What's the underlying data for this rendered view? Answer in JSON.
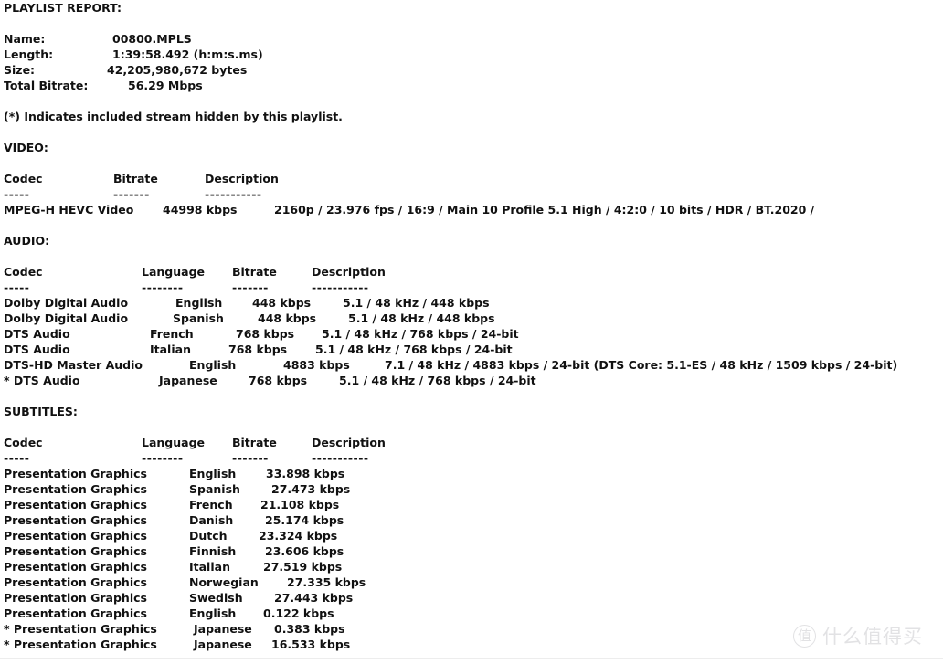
{
  "report": {
    "title": "PLAYLIST REPORT:",
    "note": "(*) Indicates included stream hidden by this playlist.",
    "meta": [
      {
        "key": "Name:",
        "value": "00800.MPLS"
      },
      {
        "key": "Length:",
        "value": "1:39:58.492 (h:m:s.ms)"
      },
      {
        "key": "Size:",
        "value": "42,205,980,672 bytes"
      },
      {
        "key": "Total Bitrate:",
        "value": "56.29 Mbps"
      }
    ],
    "video": {
      "heading": "VIDEO:",
      "columns": {
        "codec": "Codec",
        "bitrate": "Bitrate",
        "description": "Description"
      },
      "rules": {
        "codec": "-----",
        "bitrate": "-------",
        "description": "-----------"
      },
      "rows": [
        {
          "codec": "MPEG-H HEVC Video",
          "bitrate": "44998 kbps",
          "description": "2160p / 23.976 fps / 16:9 / Main 10 Profile 5.1 High / 4:2:0 / 10 bits / HDR / BT.2020 /"
        }
      ]
    },
    "audio": {
      "heading": "AUDIO:",
      "columns": {
        "codec": "Codec",
        "language": "Language",
        "bitrate": "Bitrate",
        "description": "Description"
      },
      "rules": {
        "codec": "-----",
        "language": "--------",
        "bitrate": "-------",
        "description": "-----------"
      },
      "rows": [
        {
          "codec": "Dolby Digital Audio",
          "language": "English",
          "bitrate": "448 kbps",
          "description": "5.1 / 48 kHz / 448 kbps"
        },
        {
          "codec": "Dolby Digital Audio",
          "language": "Spanish",
          "bitrate": "448 kbps",
          "description": "5.1 / 48 kHz / 448 kbps"
        },
        {
          "codec": "DTS Audio",
          "language": "French",
          "bitrate": "768 kbps",
          "description": "5.1 / 48 kHz / 768 kbps / 24-bit"
        },
        {
          "codec": "DTS Audio",
          "language": "Italian",
          "bitrate": "768 kbps",
          "description": "5.1 / 48 kHz / 768 kbps / 24-bit"
        },
        {
          "codec": "DTS-HD Master Audio",
          "language": "English",
          "bitrate": "4883 kbps",
          "description": "7.1 / 48 kHz / 4883 kbps / 24-bit (DTS Core: 5.1-ES / 48 kHz / 1509 kbps / 24-bit)"
        },
        {
          "codec": "* DTS Audio",
          "language": "Japanese",
          "bitrate": "768 kbps",
          "description": "5.1 / 48 kHz / 768 kbps / 24-bit"
        }
      ]
    },
    "subtitles": {
      "heading": "SUBTITLES:",
      "columns": {
        "codec": "Codec",
        "language": "Language",
        "bitrate": "Bitrate",
        "description": "Description"
      },
      "rules": {
        "codec": "-----",
        "language": "--------",
        "bitrate": "-------",
        "description": "-----------"
      },
      "rows": [
        {
          "codec": "Presentation Graphics",
          "language": "English",
          "bitrate": "33.898 kbps",
          "description": ""
        },
        {
          "codec": "Presentation Graphics",
          "language": "Spanish",
          "bitrate": "27.473 kbps",
          "description": ""
        },
        {
          "codec": "Presentation Graphics",
          "language": "French",
          "bitrate": "21.108 kbps",
          "description": ""
        },
        {
          "codec": "Presentation Graphics",
          "language": "Danish",
          "bitrate": "25.174 kbps",
          "description": ""
        },
        {
          "codec": "Presentation Graphics",
          "language": "Dutch",
          "bitrate": "23.324 kbps",
          "description": ""
        },
        {
          "codec": "Presentation Graphics",
          "language": "Finnish",
          "bitrate": "23.606 kbps",
          "description": ""
        },
        {
          "codec": "Presentation Graphics",
          "language": "Italian",
          "bitrate": "27.519 kbps",
          "description": ""
        },
        {
          "codec": "Presentation Graphics",
          "language": "Norwegian",
          "bitrate": "27.335 kbps",
          "description": ""
        },
        {
          "codec": "Presentation Graphics",
          "language": "Swedish",
          "bitrate": "27.443 kbps",
          "description": ""
        },
        {
          "codec": "Presentation Graphics",
          "language": "English",
          "bitrate": "0.122 kbps",
          "description": ""
        },
        {
          "codec": "* Presentation Graphics",
          "language": "Japanese",
          "bitrate": "0.383 kbps",
          "description": ""
        },
        {
          "codec": "* Presentation Graphics",
          "language": "Japanese",
          "bitrate": "16.533 kbps",
          "description": ""
        }
      ]
    }
  },
  "watermark": {
    "mark": "值",
    "text": "什么值得买"
  }
}
